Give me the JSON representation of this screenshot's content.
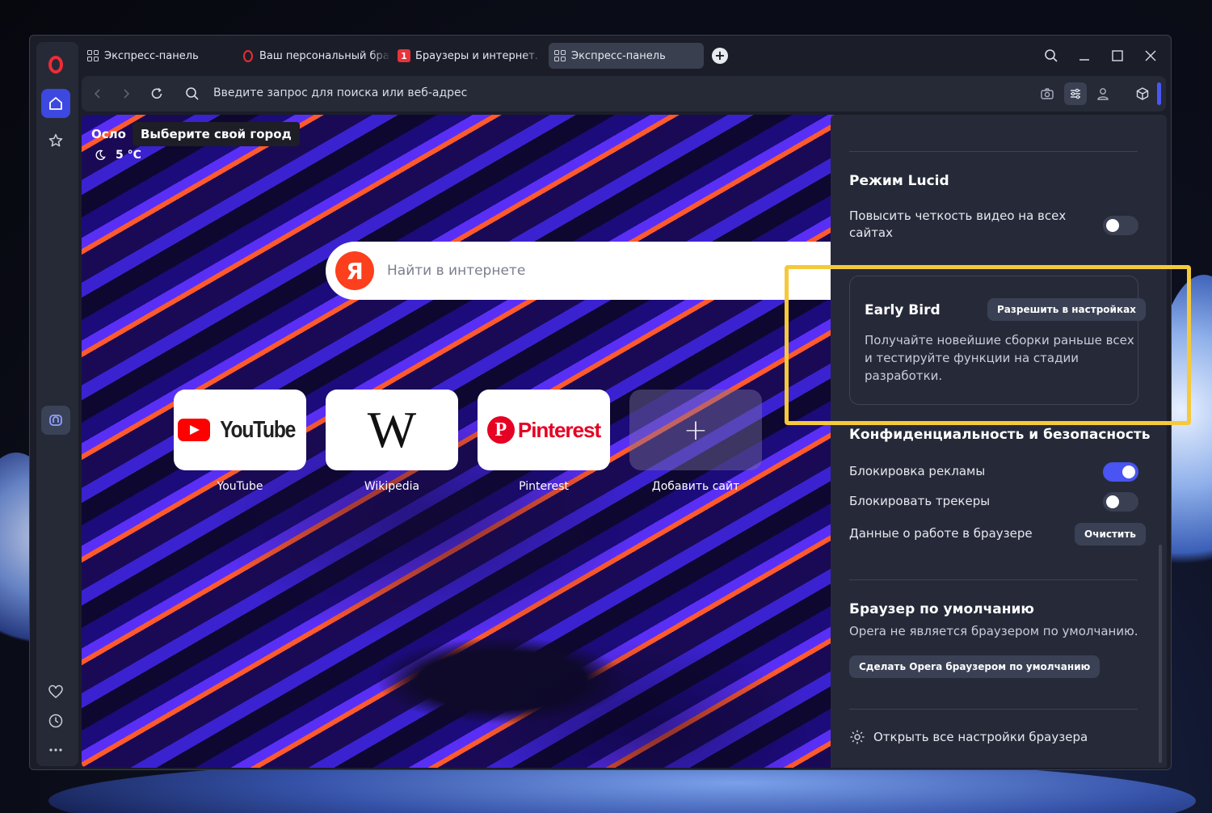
{
  "tabs": [
    {
      "label": "Экспресс-панель",
      "icon": "speed-dial-icon"
    },
    {
      "label": "Ваш персональный брау",
      "icon": "opera-icon"
    },
    {
      "label": "Браузеры и интернет. Ск",
      "icon": "red-badge-icon"
    },
    {
      "label": "Экспресс-панель",
      "icon": "speed-dial-icon",
      "active": true
    }
  ],
  "addressbar": {
    "placeholder": "Введите запрос для поиска или веб-адрес"
  },
  "weather": {
    "city": "Осло",
    "chip": "Выберите свой город",
    "temp": "5 °C"
  },
  "search": {
    "placeholder": "Найти в интернете",
    "engine_badge": "Я"
  },
  "speeddial": [
    {
      "label": "YouTube",
      "logo": "YouTube"
    },
    {
      "label": "Wikipedia",
      "logo": "W"
    },
    {
      "label": "Pinterest",
      "logo": "Pinterest",
      "logo_mark": "P"
    },
    {
      "label": "Добавить сайт",
      "logo": "+"
    }
  ],
  "panel": {
    "lucid": {
      "title": "Режим Lucid",
      "desc_line1": "Повысить четкость видео на всех",
      "desc_line2": "сайтах",
      "enabled": false
    },
    "early_bird": {
      "title": "Early Bird",
      "button": "Разрешить в настройках",
      "line1": "Получайте новейшие сборки раньше всех",
      "line2": "и тестируйте функции на стадии",
      "line3": "разработки."
    },
    "privacy": {
      "title": "Конфиденциальность и безопасность",
      "adblock": "Блокировка рекламы",
      "adblock_enabled": true,
      "trackers": "Блокировать трекеры",
      "trackers_enabled": false,
      "data": "Данные о работе в браузере",
      "clear_button": "Очистить"
    },
    "default_browser": {
      "title": "Браузер по умолчанию",
      "desc": "Opera не является браузером по умолчанию.",
      "button": "Сделать Opera браузером по умолчанию"
    },
    "open_settings": "Открыть все настройки браузера"
  },
  "colors": {
    "accent": "#4954f2",
    "highlight": "#f5c93a",
    "opera_red": "#ef2c36"
  }
}
